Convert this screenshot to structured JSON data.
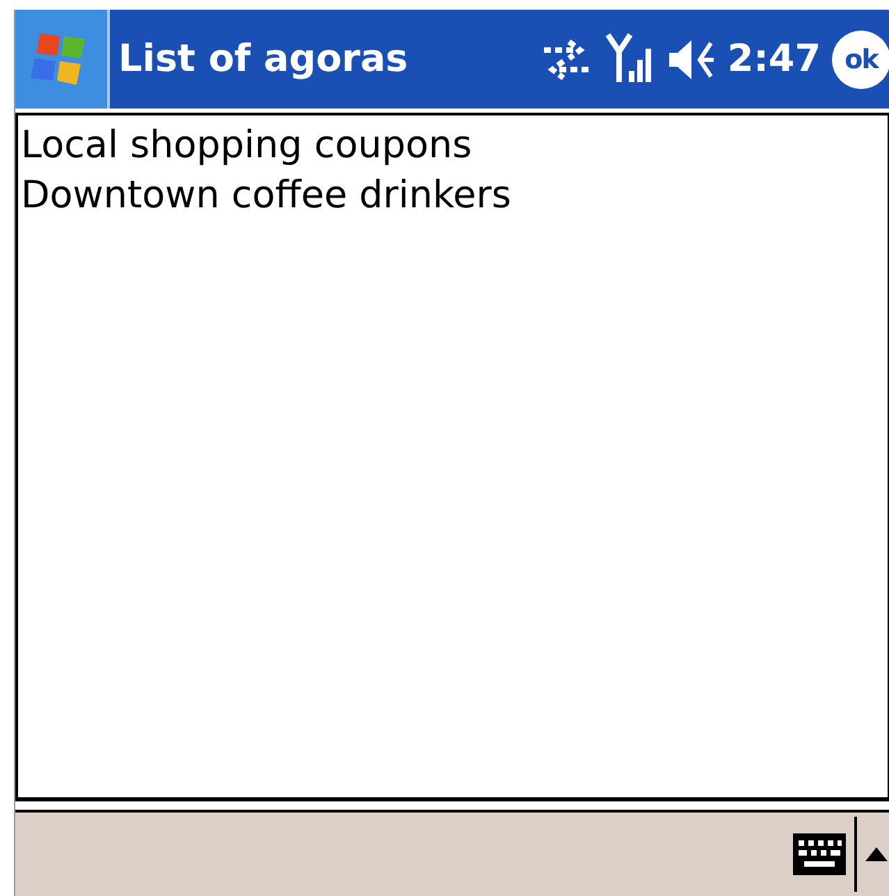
{
  "window": {
    "title": "List of agoras",
    "time": "2:47",
    "ok_button": "ok"
  },
  "list": {
    "items": [
      {
        "label": "Local shopping coupons"
      },
      {
        "label": "Downtown coffee drinkers"
      }
    ]
  }
}
